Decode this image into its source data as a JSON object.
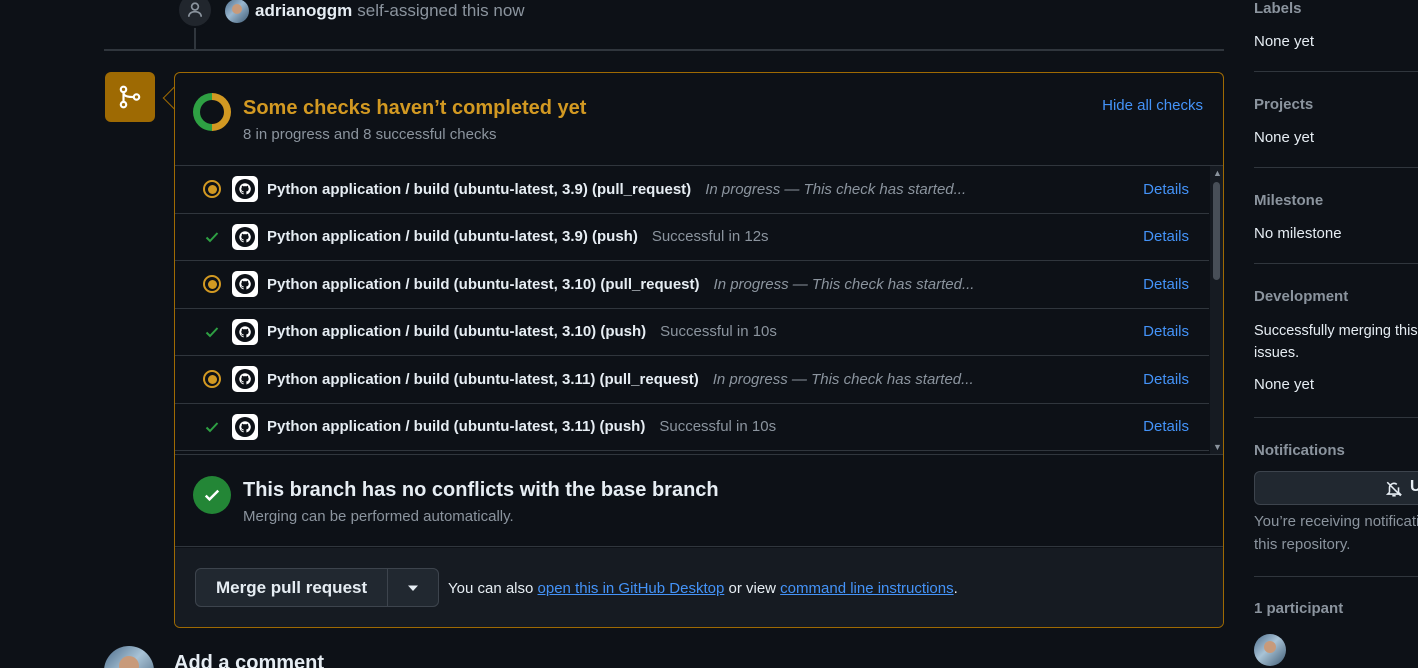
{
  "timeline": {
    "user": "adrianoggm",
    "event_text": "self-assigned this now"
  },
  "checks": {
    "title": "Some checks haven’t completed yet",
    "subtitle": "8 in progress and 8 successful checks",
    "hide_label": "Hide all checks",
    "items": [
      {
        "name": "Python application / build (ubuntu-latest, 3.9) (pull_request)",
        "status": "In progress — This check has started...",
        "state": "in-progress",
        "details": "Details"
      },
      {
        "name": "Python application / build (ubuntu-latest, 3.9) (push)",
        "status": "Successful in 12s",
        "state": "success",
        "details": "Details"
      },
      {
        "name": "Python application / build (ubuntu-latest, 3.10) (pull_request)",
        "status": "In progress — This check has started...",
        "state": "in-progress",
        "details": "Details"
      },
      {
        "name": "Python application / build (ubuntu-latest, 3.10) (push)",
        "status": "Successful in 10s",
        "state": "success",
        "details": "Details"
      },
      {
        "name": "Python application / build (ubuntu-latest, 3.11) (pull_request)",
        "status": "In progress — This check has started...",
        "state": "in-progress",
        "details": "Details"
      },
      {
        "name": "Python application / build (ubuntu-latest, 3.11) (push)",
        "status": "Successful in 10s",
        "state": "success",
        "details": "Details"
      }
    ]
  },
  "conflicts": {
    "title": "This branch has no conflicts with the base branch",
    "subtitle": "Merging can be performed automatically."
  },
  "merge": {
    "button_label": "Merge pull request",
    "also_prefix": "You can also",
    "desktop_link": "open this in GitHub Desktop",
    "or_view": "or view",
    "cli_link": "command line instructions",
    "period": "."
  },
  "comment": {
    "title": "Add a comment"
  },
  "sidebar": {
    "labels": {
      "heading": "Labels",
      "value": "None yet"
    },
    "projects": {
      "heading": "Projects",
      "value": "None yet"
    },
    "milestone": {
      "heading": "Milestone",
      "value": "No milestone"
    },
    "development": {
      "heading": "Development",
      "text_line1": "Successfully merging this",
      "text_line2": "issues.",
      "value": "None yet"
    },
    "notifications": {
      "heading": "Notifications",
      "button_label": "U",
      "text_line1": "You’re receiving notificati",
      "text_line2": "this repository."
    },
    "participants": {
      "heading": "1 participant"
    }
  },
  "colors": {
    "pending": "#d29922",
    "success": "#2ea043",
    "link": "#4493f8"
  }
}
